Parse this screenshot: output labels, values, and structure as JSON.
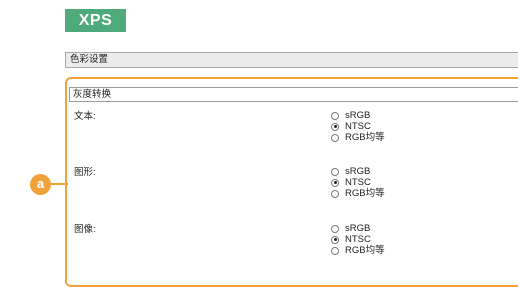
{
  "badge": {
    "label": "XPS"
  },
  "color_settings": {
    "title": "色彩设置"
  },
  "grayscale": {
    "title": "灰度转换"
  },
  "callout": {
    "letter": "a"
  },
  "rows": [
    {
      "label": "文本:",
      "options": [
        "sRGB",
        "NTSC",
        "RGB均等"
      ],
      "selected": "NTSC"
    },
    {
      "label": "图形:",
      "options": [
        "sRGB",
        "NTSC",
        "RGB均等"
      ],
      "selected": "NTSC"
    },
    {
      "label": "图像:",
      "options": [
        "sRGB",
        "NTSC",
        "RGB均等"
      ],
      "selected": "NTSC"
    }
  ],
  "colors": {
    "accent": "#f2a23a",
    "badge": "#4ea97b"
  }
}
